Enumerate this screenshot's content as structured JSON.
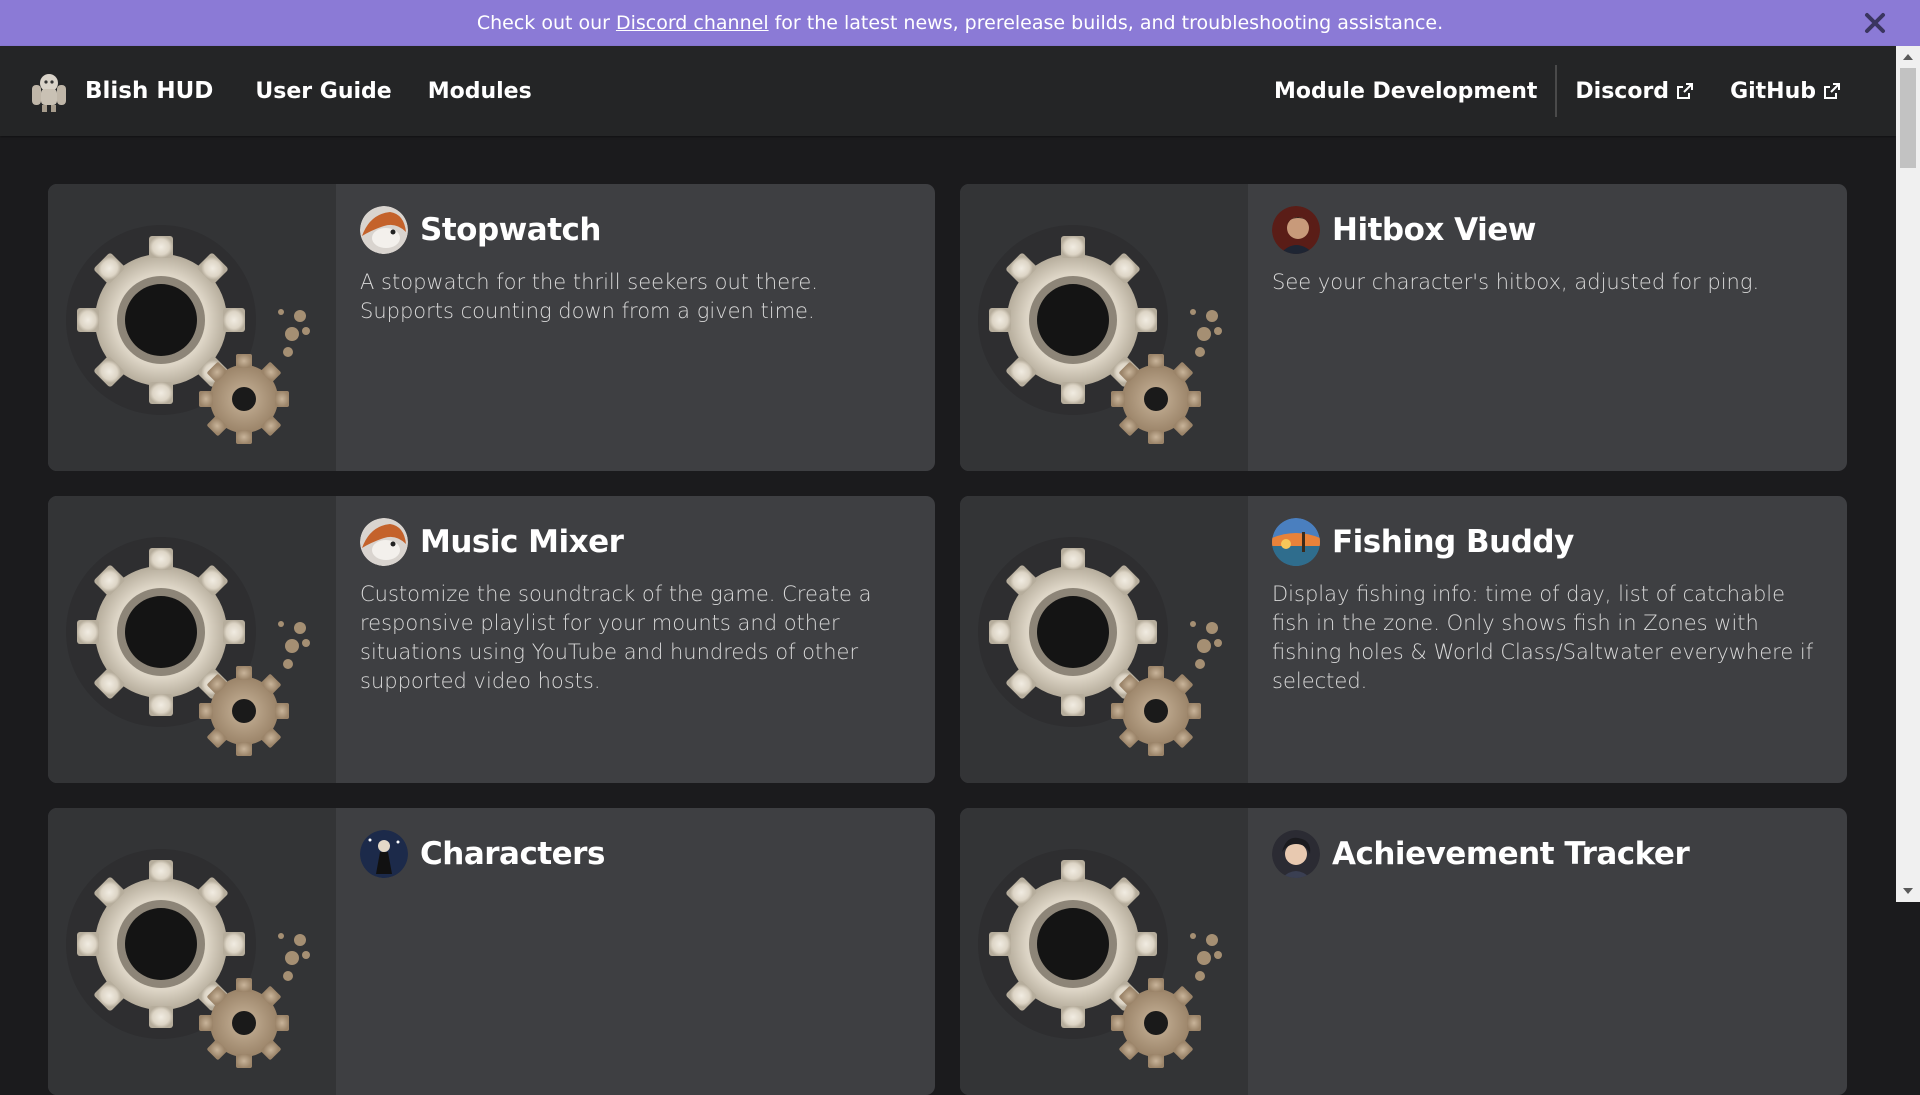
{
  "banner": {
    "prefix": "Check out our",
    "link": "Discord channel",
    "suffix": "for the latest news, prerelease builds, and troubleshooting assistance.",
    "background": "#8b7ad6"
  },
  "navbar": {
    "brand": "Blish HUD",
    "links": [
      "User Guide",
      "Modules"
    ],
    "right": {
      "module_dev": "Module Development",
      "discord": "Discord",
      "github": "GitHub"
    }
  },
  "modules": [
    {
      "title": "Stopwatch",
      "description": "A stopwatch for the thrill seekers out there. Supports counting down from a given time.",
      "avatar": "red-panda-avatar"
    },
    {
      "title": "Hitbox View",
      "description": "See your character's hitbox, adjusted for ping.",
      "avatar": "character-portrait-avatar"
    },
    {
      "title": "Music Mixer",
      "description": "Customize the soundtrack of the game. Create a responsive playlist for your mounts and other situations using YouTube and hundreds of other supported video hosts.",
      "avatar": "red-panda-avatar"
    },
    {
      "title": "Fishing Buddy",
      "description": "Display fishing info: time of day, list of catchable fish in the zone. Only shows fish in Zones with fishing holes & World Class/Saltwater everywhere if selected.",
      "avatar": "sunset-avatar"
    },
    {
      "title": "Characters",
      "description": "",
      "avatar": "night-character-avatar"
    },
    {
      "title": "Achievement Tracker",
      "description": "",
      "avatar": "anime-character-avatar"
    }
  ]
}
